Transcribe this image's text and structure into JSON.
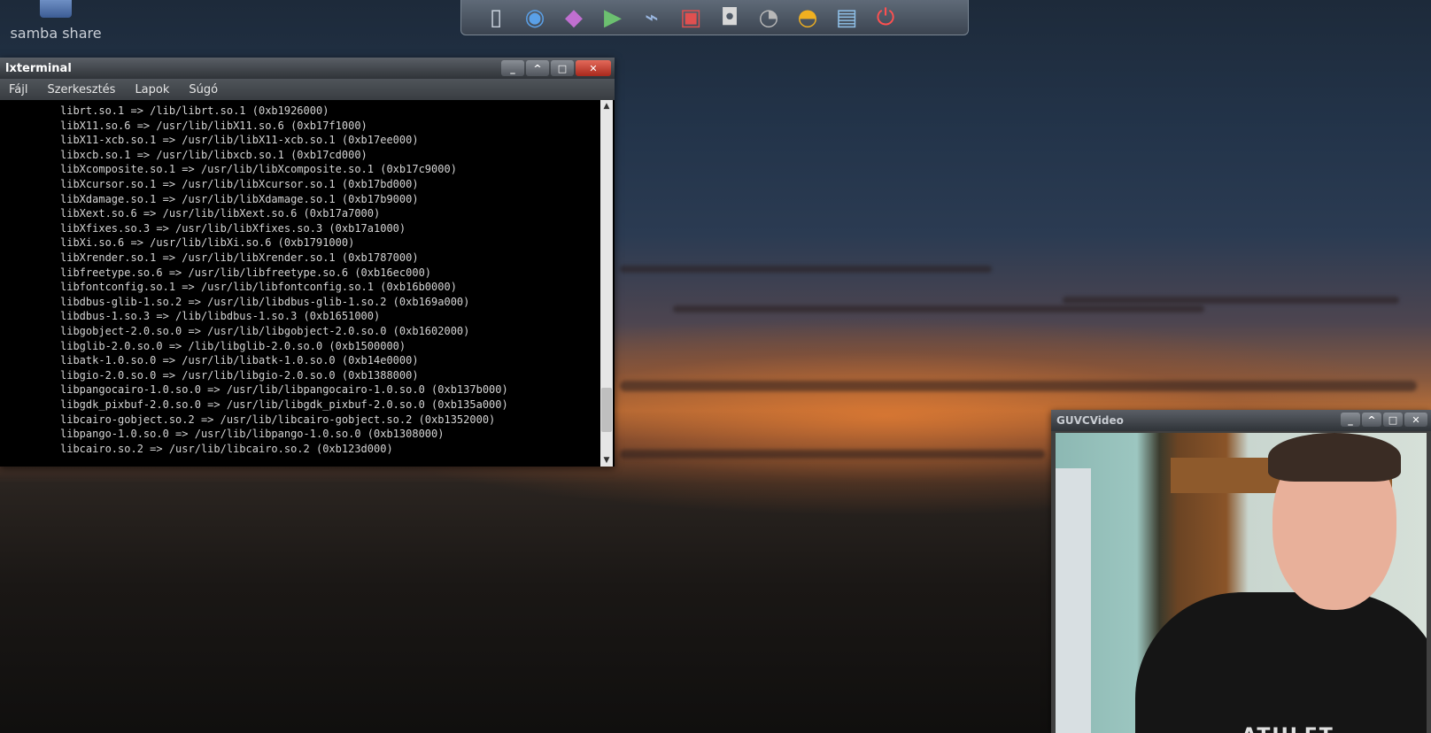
{
  "desktop": {
    "icon_label": "samba share"
  },
  "dock": {
    "items": [
      {
        "icon": "text-editor-icon",
        "glyph": "▯",
        "color": "#c8d0dc"
      },
      {
        "icon": "browser-globe-icon",
        "glyph": "◉",
        "color": "#5aa0e8"
      },
      {
        "icon": "settings-tools-icon",
        "glyph": "◆",
        "color": "#c06fd0"
      },
      {
        "icon": "media-player-icon",
        "glyph": "▶",
        "color": "#6cc070"
      },
      {
        "icon": "graphics-icon",
        "glyph": "⌁",
        "color": "#9ab7e0"
      },
      {
        "icon": "office-document-icon",
        "glyph": "▣",
        "color": "#e05050"
      },
      {
        "icon": "camera-icon",
        "glyph": "◘",
        "color": "#d8d8d8"
      },
      {
        "icon": "speaker-icon",
        "glyph": "◔",
        "color": "#b8b8b8"
      },
      {
        "icon": "shell-icon",
        "glyph": "◓",
        "color": "#f0b020"
      },
      {
        "icon": "network-icon",
        "glyph": "▤",
        "color": "#8fc0e8"
      },
      {
        "icon": "power-icon",
        "glyph": "⏻",
        "color": "#ff5050"
      }
    ]
  },
  "terminal": {
    "title": "lxterminal",
    "menu": [
      "Fájl",
      "Szerkesztés",
      "Lapok",
      "Súgó"
    ],
    "lines": [
      "librt.so.1 => /lib/librt.so.1 (0xb1926000)",
      "libX11.so.6 => /usr/lib/libX11.so.6 (0xb17f1000)",
      "libX11-xcb.so.1 => /usr/lib/libX11-xcb.so.1 (0xb17ee000)",
      "libxcb.so.1 => /usr/lib/libxcb.so.1 (0xb17cd000)",
      "libXcomposite.so.1 => /usr/lib/libXcomposite.so.1 (0xb17c9000)",
      "libXcursor.so.1 => /usr/lib/libXcursor.so.1 (0xb17bd000)",
      "libXdamage.so.1 => /usr/lib/libXdamage.so.1 (0xb17b9000)",
      "libXext.so.6 => /usr/lib/libXext.so.6 (0xb17a7000)",
      "libXfixes.so.3 => /usr/lib/libXfixes.so.3 (0xb17a1000)",
      "libXi.so.6 => /usr/lib/libXi.so.6 (0xb1791000)",
      "libXrender.so.1 => /usr/lib/libXrender.so.1 (0xb1787000)",
      "libfreetype.so.6 => /usr/lib/libfreetype.so.6 (0xb16ec000)",
      "libfontconfig.so.1 => /usr/lib/libfontconfig.so.1 (0xb16b0000)",
      "libdbus-glib-1.so.2 => /usr/lib/libdbus-glib-1.so.2 (0xb169a000)",
      "libdbus-1.so.3 => /lib/libdbus-1.so.3 (0xb1651000)",
      "libgobject-2.0.so.0 => /usr/lib/libgobject-2.0.so.0 (0xb1602000)",
      "libglib-2.0.so.0 => /lib/libglib-2.0.so.0 (0xb1500000)",
      "libatk-1.0.so.0 => /usr/lib/libatk-1.0.so.0 (0xb14e0000)",
      "libgio-2.0.so.0 => /usr/lib/libgio-2.0.so.0 (0xb1388000)",
      "libpangocairo-1.0.so.0 => /usr/lib/libpangocairo-1.0.so.0 (0xb137b000)",
      "libgdk_pixbuf-2.0.so.0 => /usr/lib/libgdk_pixbuf-2.0.so.0 (0xb135a000)",
      "libcairo-gobject.so.2 => /usr/lib/libcairo-gobject.so.2 (0xb1352000)",
      "libpango-1.0.so.0 => /usr/lib/libpango-1.0.so.0 (0xb1308000)",
      "libcairo.so.2 => /usr/lib/libcairo.so.2 (0xb123d000)"
    ]
  },
  "video_window": {
    "title": "GUVCVideo",
    "shirt_text": "ATHLET"
  }
}
